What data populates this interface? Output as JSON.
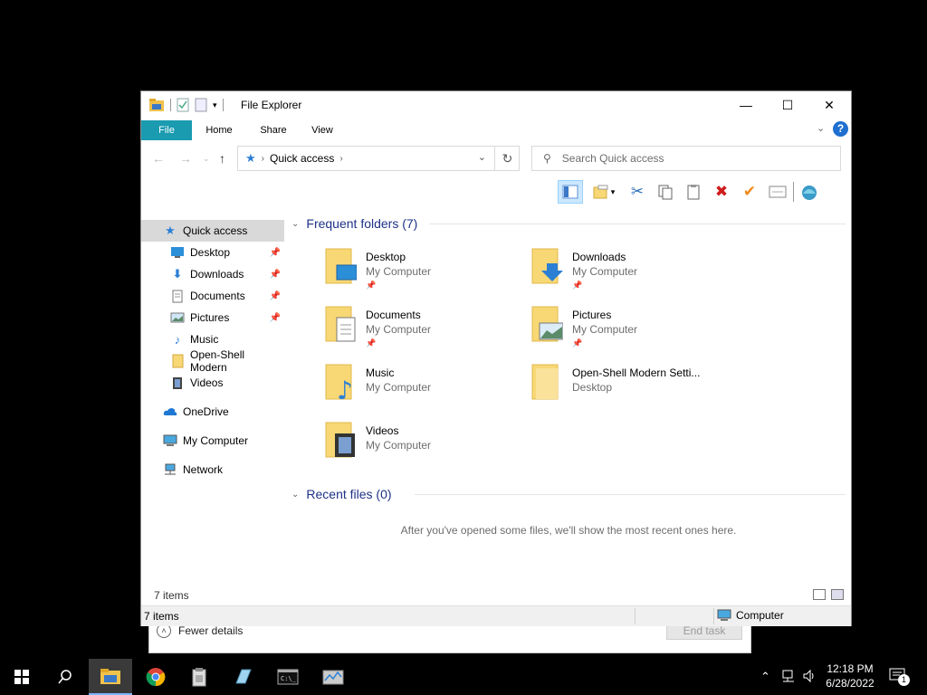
{
  "background_window": {
    "fewer_details_label": "Fewer details",
    "end_task_label": "End task"
  },
  "window": {
    "title": "File Explorer",
    "controls": {
      "minimize": "—",
      "maximize": "☐",
      "close": "✕"
    }
  },
  "ribbon": {
    "tabs": [
      "File",
      "Home",
      "Share",
      "View"
    ],
    "help_label": "?"
  },
  "address_bar": {
    "path": "Quick access",
    "search_placeholder": "Search Quick access"
  },
  "nav_pane": {
    "items": [
      {
        "label": "Quick access",
        "icon": "star-icon"
      },
      {
        "label": "Desktop",
        "icon": "desktop-icon",
        "pinned": true
      },
      {
        "label": "Downloads",
        "icon": "downloads-icon",
        "pinned": true
      },
      {
        "label": "Documents",
        "icon": "documents-icon",
        "pinned": true
      },
      {
        "label": "Pictures",
        "icon": "pictures-icon",
        "pinned": true
      },
      {
        "label": "Music",
        "icon": "music-icon"
      },
      {
        "label": "Open-Shell Modern",
        "icon": "folder-icon"
      },
      {
        "label": "Videos",
        "icon": "videos-icon"
      },
      {
        "label": "OneDrive",
        "icon": "cloud-icon"
      },
      {
        "label": "My Computer",
        "icon": "computer-icon"
      },
      {
        "label": "Network",
        "icon": "network-icon"
      }
    ]
  },
  "content": {
    "frequent_header": "Frequent folders (7)",
    "recent_header": "Recent files (0)",
    "empty_message": "After you've opened some files, we'll show the most recent ones here.",
    "folders": [
      {
        "name": "Desktop",
        "location": "My Computer",
        "pinned": true
      },
      {
        "name": "Downloads",
        "location": "My Computer",
        "pinned": true
      },
      {
        "name": "Documents",
        "location": "My Computer",
        "pinned": true
      },
      {
        "name": "Pictures",
        "location": "My Computer",
        "pinned": true
      },
      {
        "name": "Music",
        "location": "My Computer",
        "pinned": false
      },
      {
        "name": "Open-Shell Modern Setti...",
        "location": "Desktop",
        "pinned": false
      },
      {
        "name": "Videos",
        "location": "My Computer",
        "pinned": false
      }
    ]
  },
  "status": {
    "items_count": "7 items",
    "items_count_bottom": "7 items",
    "zone": "Computer"
  },
  "taskbar": {
    "time": "12:18 PM",
    "date": "6/28/2022",
    "notification_count": "1"
  },
  "colors": {
    "file_tab": "#1a9bb0",
    "group_header": "#1e3287",
    "folder_yellow": "#f8d775",
    "selection": "#cce8ff"
  }
}
